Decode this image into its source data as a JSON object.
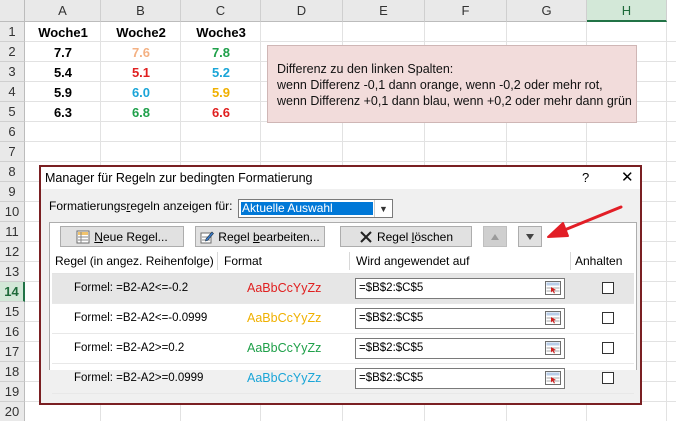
{
  "sheet": {
    "columns": [
      "A",
      "B",
      "C",
      "D",
      "E",
      "F",
      "G",
      "H"
    ],
    "selected_column": "H",
    "rows": [
      "1",
      "2",
      "3",
      "4",
      "5",
      "6",
      "7",
      "8",
      "9",
      "10",
      "11",
      "12",
      "13",
      "14",
      "15",
      "16",
      "17",
      "18",
      "19",
      "20"
    ],
    "selected_row": "14",
    "headers": [
      "Woche1",
      "Woche2",
      "Woche3"
    ],
    "data": [
      [
        {
          "v": "7.7",
          "c": "#000000"
        },
        {
          "v": "7.6",
          "c": "#f4b183"
        },
        {
          "v": "7.8",
          "c": "#1fa04a"
        }
      ],
      [
        {
          "v": "5.4",
          "c": "#000000"
        },
        {
          "v": "5.1",
          "c": "#e02020"
        },
        {
          "v": "5.2",
          "c": "#1aa5d8"
        }
      ],
      [
        {
          "v": "5.9",
          "c": "#000000"
        },
        {
          "v": "6.0",
          "c": "#1aa5d8"
        },
        {
          "v": "5.9",
          "c": "#f0b000"
        }
      ],
      [
        {
          "v": "6.3",
          "c": "#000000"
        },
        {
          "v": "6.8",
          "c": "#1fa04a"
        },
        {
          "v": "6.6",
          "c": "#e02020"
        }
      ]
    ],
    "note_lines": [
      "Differenz zu den linken Spalten:",
      "wenn Differenz -0,1 dann orange, wenn -0,2 oder mehr rot,",
      "wenn Differenz +0,1 dann blau, wenn +0,2 oder mehr dann grün"
    ]
  },
  "dialog": {
    "title": "Manager für Regeln zur bedingten Formatierung",
    "help": "?",
    "close": "✕",
    "show_label_pre": "Formatierungs",
    "show_label_ul": "r",
    "show_label_post": "egeln anzeigen für:",
    "scope_value": "Aktuelle Auswahl",
    "buttons": {
      "new_ul": "N",
      "new_rest": "eue Regel...",
      "edit_pre": "Regel ",
      "edit_ul": "b",
      "edit_post": "earbeiten...",
      "delete_pre": "Regel ",
      "delete_ul": "l",
      "delete_post": "öschen"
    },
    "columns": {
      "rule": "Regel (in angez. Reihenfolge)",
      "format": "Format",
      "applies": "Wird angewendet auf",
      "stop": "Anhalten"
    },
    "rules": [
      {
        "name": "Formel: =B2-A2<=-0.2",
        "preview": "AaBbCcYyZz",
        "color": "#e02020",
        "applies": "=$B$2:$C$5",
        "selected": true
      },
      {
        "name": "Formel: =B2-A2<=-0.0999",
        "preview": "AaBbCcYyZz",
        "color": "#f0b000",
        "applies": "=$B$2:$C$5",
        "selected": false
      },
      {
        "name": "Formel: =B2-A2>=0.2",
        "preview": "AaBbCcYyZz",
        "color": "#1fa04a",
        "applies": "=$B$2:$C$5",
        "selected": false
      },
      {
        "name": "Formel: =B2-A2>=0.0999",
        "preview": "AaBbCcYyZz",
        "color": "#1aa5d8",
        "applies": "=$B$2:$C$5",
        "selected": false
      }
    ]
  },
  "colors": {
    "annotation_arrow": "#e21e26",
    "dialog_border": "#7a1f22",
    "note_fill": "#f2dcdb"
  }
}
